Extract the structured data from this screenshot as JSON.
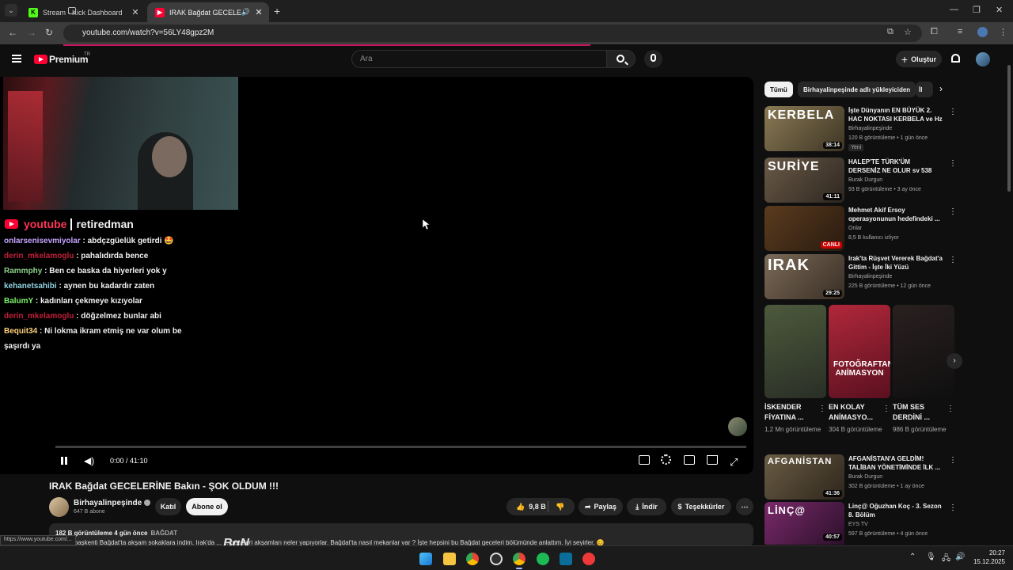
{
  "browser": {
    "tabs": [
      {
        "title": "Stream - Kick Dashboard",
        "active": false
      },
      {
        "title": "IRAK Bağdat GECELERİNE B",
        "active": true
      }
    ],
    "url": "youtube.com/watch?v=56LY48gpz2M",
    "status_url": "https://www.youtube.com/..."
  },
  "header": {
    "logo": "Premium",
    "region": "TR",
    "search_placeholder": "Ara",
    "create_label": "Oluştur"
  },
  "player": {
    "brand": "youtube",
    "channel_overlay": "retiredman",
    "time": "0:00 / 41:10",
    "chat": [
      {
        "user": "onlarsenisevmiyolar",
        "text": ": abdçzgüelük getirdi 🤩",
        "color": "#c5a3ff"
      },
      {
        "user": "derin_mkelamoglu",
        "text": ": pahalıdırda bence",
        "color": "#c21e3a"
      },
      {
        "user": "Rammphy",
        "text": ": Ben ce baska da hiyerleri yok y",
        "color": "#8fd18b"
      },
      {
        "user": "kehanetsahibi",
        "text": ": aynen bu kadardır zaten",
        "color": "#8fd1e0"
      },
      {
        "user": "BalumY",
        "text": ": kadınları çekmeye kızıyolar",
        "color": "#7bf26a"
      },
      {
        "user": "derin_mkelamoglu",
        "text": ": döğzelmez bunlar abi",
        "color": "#c21e3a"
      },
      {
        "user": "Bequit34",
        "text": ": Ni lokma ikram etmiş ne var olum be şaşırdı ya",
        "color": "#ffd27a"
      }
    ]
  },
  "video": {
    "title": "IRAK Bağdat GECELERİNE Bakın - ŞOK OLDUM !!!",
    "channel": "Birhayalinpeşinde",
    "subscribers": "647 B abone",
    "join_label": "Katıl",
    "subscribe_label": "Abone ol",
    "likes": "9,8 B",
    "share_label": "Paylaş",
    "download_label": "İndir",
    "thanks_label": "Teşekkürler",
    "views_date": "182 B görüntüleme  4 gün önce",
    "tag": "BAĞDAT",
    "description": "Irak'ın başkenti Bağdat'ta akşam sokaklara indim. Irak'da ... ... geceleri akşamları neler yapıyorlar. Bağdat'ta nasıl mekanlar var ? İşte hepsini bu Bağdat geceleri bölümünde anlattım. İyi seyirler. 😊"
  },
  "watermark": "BgN",
  "sidebar": {
    "chips": [
      "Tümü",
      "Birhayalinpeşinde adlı yükleyiciden",
      "İl"
    ],
    "recs": [
      {
        "title": "İşte Dünyanın EN BÜYÜK 2. HAC NOKTASI KERBELA ve Hz ...",
        "channel": "Birhayalinpeşinde",
        "meta": "120 B görüntüleme • 1 gün önce",
        "badge": "Yeni",
        "duration": "38:14",
        "thumb_text": "KERBELA"
      },
      {
        "title": "HALEP'TE TÜRK'ÜM DERSENİZ NE OLUR sv 538",
        "channel": "Burak Durgun",
        "meta": "93 B görüntüleme • 3 ay önce",
        "badge": "",
        "duration": "41:11",
        "thumb_text": "SURİYE"
      },
      {
        "title": "Mehmet Akif Ersoy operasyonunun hedefindeki ...",
        "channel": "Onlar",
        "meta": "8,5 B kullanıcı izliyor",
        "badge": "",
        "duration": "CANLI",
        "thumb_text": ""
      },
      {
        "title": "Irak'ta Rüşvet Vererek Bağdat'a Gittim - İşte İki Yüzü",
        "channel": "Birhayalinpeşinde",
        "meta": "225 B görüntüleme • 12 gün önce",
        "badge": "",
        "duration": "29:25",
        "thumb_text": "IRAK"
      }
    ],
    "shorts": [
      {
        "title": "İSKENDER FİYATINA ...",
        "views": "1,2 Mn görüntüleme",
        "overlay": ""
      },
      {
        "title": "EN KOLAY ANİMASYO...",
        "views": "304 B görüntüleme",
        "overlay": "FOTOĞRAFTAN ANİMASYON"
      },
      {
        "title": "TÜM SES DERDİNİ ...",
        "views": "986 B görüntüleme",
        "overlay": ""
      }
    ],
    "recs2": [
      {
        "title": "AFGANİSTAN'A GELDİM! TALİBAN YÖNETİMİNDE İLK ...",
        "channel": "Burak Durgun",
        "meta": "302 B görüntüleme • 1 ay önce",
        "duration": "41:36",
        "thumb_text": "AFGANİSTAN"
      },
      {
        "title": "Linç@ Oğuzhan Koç - 3. Sezon 8. Bölüm",
        "channel": "EYS TV",
        "meta": "597 B görüntüleme • 4 gün önce",
        "duration": "40:57",
        "thumb_text": "LİNÇ@"
      }
    ]
  },
  "taskbar": {
    "time": "20:27",
    "date": "15.12.2025"
  }
}
